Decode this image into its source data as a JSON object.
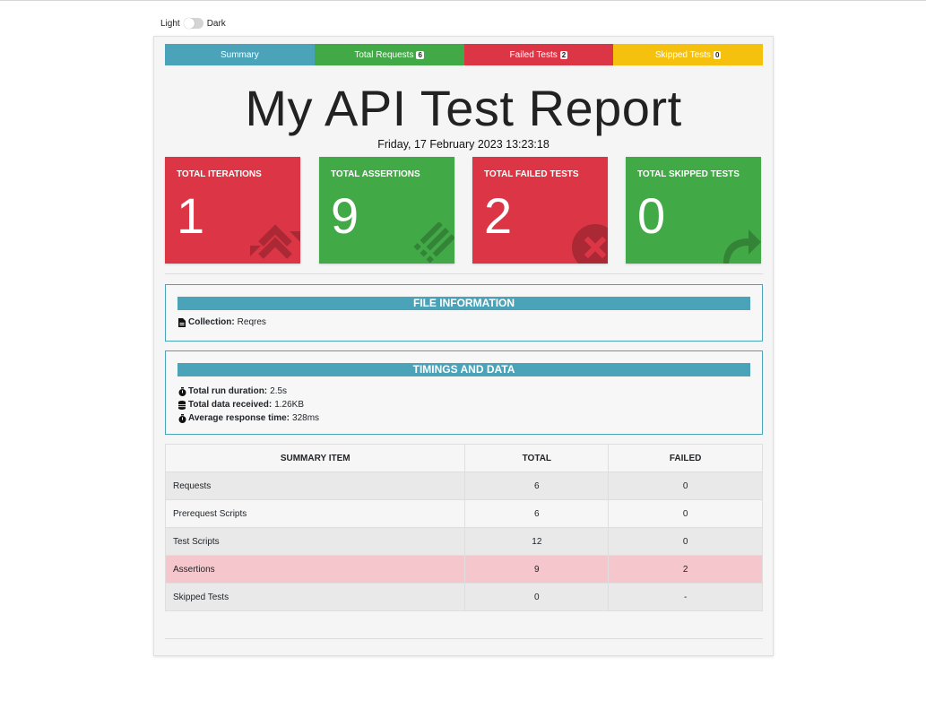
{
  "theme": {
    "light_label": "Light",
    "dark_label": "Dark"
  },
  "tabs": [
    {
      "label": "Summary",
      "badge": ""
    },
    {
      "label": "Total Requests",
      "badge": "6"
    },
    {
      "label": "Failed Tests",
      "badge": "2"
    },
    {
      "label": "Skipped Tests",
      "badge": "0"
    }
  ],
  "report": {
    "title": "My API Test Report",
    "date": "Friday, 17 February 2023 13:23:18"
  },
  "stats": [
    {
      "label": "TOTAL ITERATIONS",
      "value": "1",
      "icon": "sync-icon"
    },
    {
      "label": "TOTAL ASSERTIONS",
      "value": "9",
      "icon": "list-icon"
    },
    {
      "label": "TOTAL FAILED TESTS",
      "value": "2",
      "icon": "times-circle-icon"
    },
    {
      "label": "TOTAL SKIPPED TESTS",
      "value": "0",
      "icon": "share-arrow-icon"
    }
  ],
  "file_info": {
    "heading": "FILE INFORMATION",
    "collection_label": "Collection:",
    "collection_value": "Reqres"
  },
  "timings": {
    "heading": "TIMINGS AND DATA",
    "duration_label": "Total run duration:",
    "duration_value": "2.5s",
    "data_label": "Total data received:",
    "data_value": "1.26KB",
    "avg_label": "Average response time:",
    "avg_value": "328ms"
  },
  "summary_table": {
    "headers": [
      "SUMMARY ITEM",
      "TOTAL",
      "FAILED"
    ],
    "rows": [
      {
        "item": "Requests",
        "total": "6",
        "failed": "0"
      },
      {
        "item": "Prerequest Scripts",
        "total": "6",
        "failed": "0"
      },
      {
        "item": "Test Scripts",
        "total": "12",
        "failed": "0"
      },
      {
        "item": "Assertions",
        "total": "9",
        "failed": "2"
      },
      {
        "item": "Skipped Tests",
        "total": "0",
        "failed": "-"
      }
    ]
  },
  "colors": {
    "info": "#4aa3b8",
    "success": "#42a947",
    "danger": "#dc3545",
    "warning": "#f5c10e",
    "danger_row": "#f5c6cb"
  }
}
